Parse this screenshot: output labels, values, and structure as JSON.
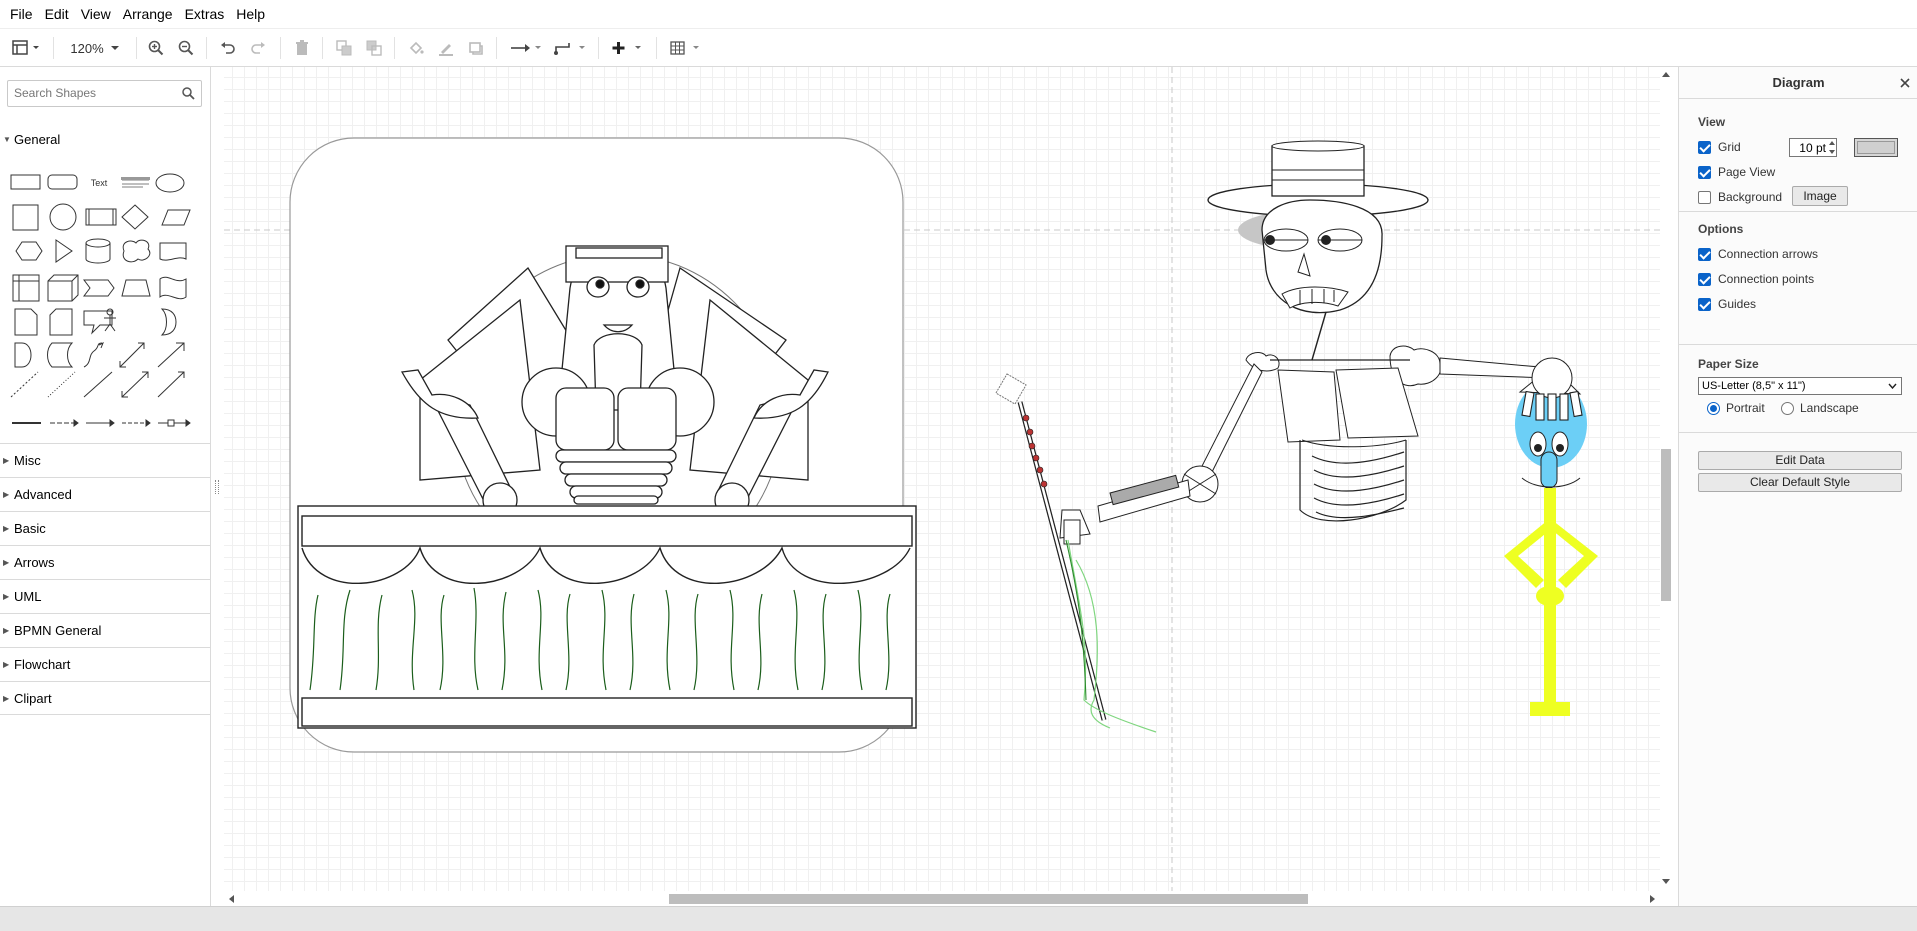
{
  "menu": [
    "File",
    "Edit",
    "View",
    "Arrange",
    "Extras",
    "Help"
  ],
  "toolbar": {
    "zoom": "120%"
  },
  "search": {
    "placeholder": "Search Shapes"
  },
  "shapes": {
    "text_label": "Text"
  },
  "palettes": [
    {
      "label": "General",
      "expanded": true
    },
    {
      "label": "Misc",
      "expanded": false
    },
    {
      "label": "Advanced",
      "expanded": false
    },
    {
      "label": "Basic",
      "expanded": false
    },
    {
      "label": "Arrows",
      "expanded": false
    },
    {
      "label": "UML",
      "expanded": false
    },
    {
      "label": "BPMN General",
      "expanded": false
    },
    {
      "label": "Flowchart",
      "expanded": false
    },
    {
      "label": "Clipart",
      "expanded": false
    }
  ],
  "format_panel": {
    "title": "Diagram",
    "view": {
      "heading": "View",
      "grid": "Grid",
      "grid_size": "10 pt",
      "page_view": "Page View",
      "background": "Background",
      "image_button": "Image"
    },
    "options": {
      "heading": "Options",
      "connection_arrows": "Connection arrows",
      "connection_points": "Connection points",
      "guides": "Guides"
    },
    "paper": {
      "heading": "Paper Size",
      "size": "US-Letter (8,5\" x 11\")",
      "portrait": "Portrait",
      "landscape": "Landscape"
    },
    "edit_data": "Edit Data",
    "clear_default_style": "Clear Default Style"
  },
  "colors": {
    "accent": "#0a63c9",
    "squidward_yellow": "#eeff22",
    "squidward_blue": "#6ccff6"
  }
}
